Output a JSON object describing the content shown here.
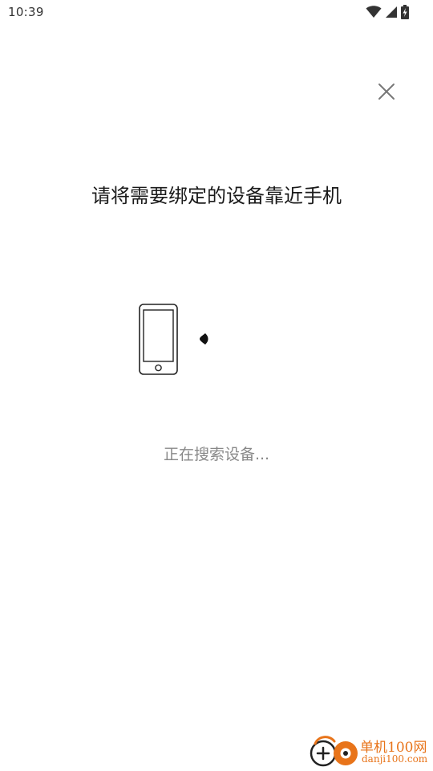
{
  "status_bar": {
    "time": "10:39",
    "icons": [
      "wifi-icon",
      "cellular-signal-icon",
      "battery-charging-icon"
    ]
  },
  "dialog": {
    "close_icon": "close-icon",
    "instruction": "请将需要绑定的设备靠近手机",
    "illustration_icon": "phone-icon",
    "signal_icon": "signal-wave-icon",
    "status_text": "正在搜索设备..."
  },
  "watermark": {
    "title": "单机100网",
    "domain": "danji100.com"
  },
  "colors": {
    "background": "#ffffff",
    "text_primary": "#1a1a1a",
    "text_secondary": "#888888",
    "icon_gray": "#777777",
    "watermark_orange": "#e8741a"
  }
}
